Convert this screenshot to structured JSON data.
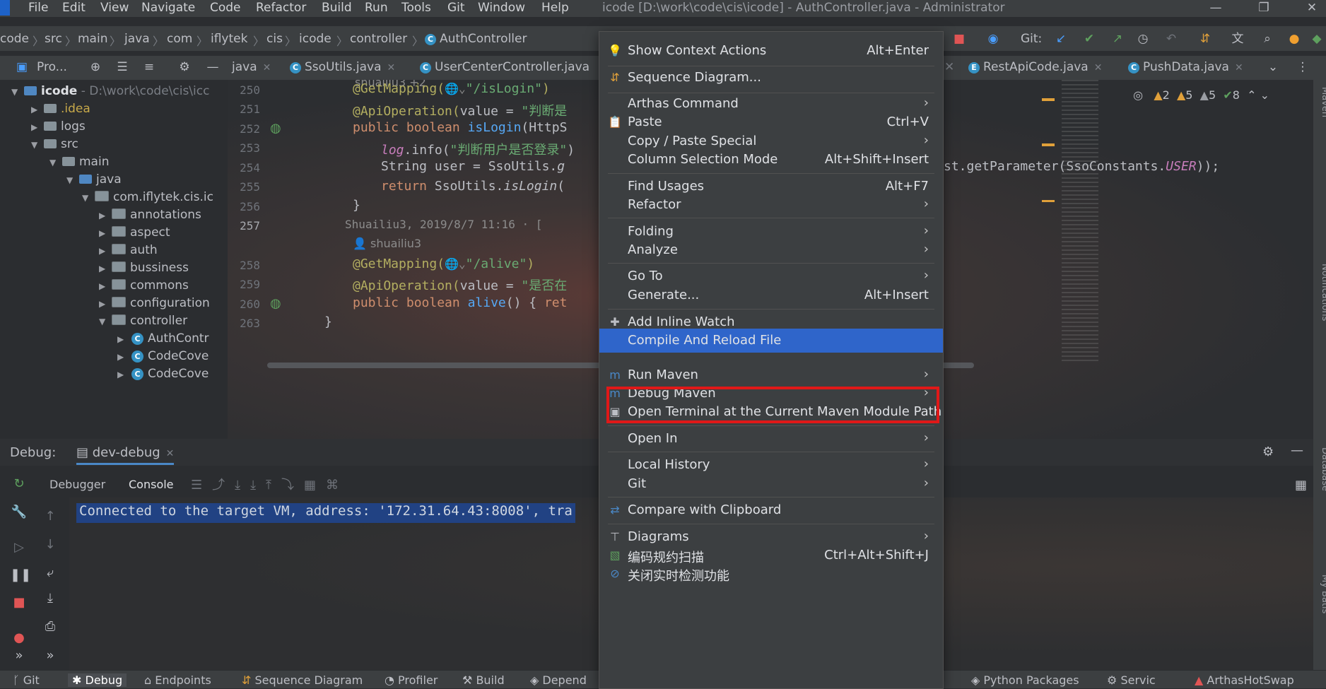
{
  "window": {
    "title": "icode [D:\\work\\code\\cis\\icode] - AuthController.java - Administrator",
    "menu": [
      "File",
      "Edit",
      "View",
      "Navigate",
      "Code",
      "Refactor",
      "Build",
      "Run",
      "Tools",
      "Git",
      "Window",
      "Help"
    ]
  },
  "navbar": {
    "breadcrumbs": [
      "code",
      "src",
      "main",
      "java",
      "com",
      "iflytek",
      "cis",
      "icode",
      "controller",
      "AuthController"
    ],
    "git_label": "Git:"
  },
  "toolbar": {
    "project_label": "Pro...",
    "tabs": [
      {
        "label": "java"
      },
      {
        "label": "SsoUtils.java"
      },
      {
        "label": "UserCenterController.java"
      },
      {
        "label": "RestApiCode.java"
      },
      {
        "label": "PushData.java"
      }
    ]
  },
  "project_tree": [
    {
      "label": "icode",
      "extra": "- D:\\work\\code\\cis\\icc",
      "depth": 0,
      "open": true
    },
    {
      "label": ".idea",
      "depth": 1,
      "open": false
    },
    {
      "label": "logs",
      "depth": 1,
      "open": false
    },
    {
      "label": "src",
      "depth": 1,
      "open": true
    },
    {
      "label": "main",
      "depth": 2,
      "open": true
    },
    {
      "label": "java",
      "depth": 3,
      "open": true
    },
    {
      "label": "com.iflytek.cis.ic",
      "depth": 4,
      "open": true
    },
    {
      "label": "annotations",
      "depth": 5,
      "open": false
    },
    {
      "label": "aspect",
      "depth": 5,
      "open": false
    },
    {
      "label": "auth",
      "depth": 5,
      "open": false
    },
    {
      "label": "bussiness",
      "depth": 5,
      "open": false
    },
    {
      "label": "commons",
      "depth": 5,
      "open": false
    },
    {
      "label": "configuration",
      "depth": 5,
      "open": false
    },
    {
      "label": "controller",
      "depth": 5,
      "open": true
    },
    {
      "label": "AuthContr",
      "depth": 6,
      "open": false
    },
    {
      "label": "CodeCove",
      "depth": 6,
      "open": false
    },
    {
      "label": "CodeCove",
      "depth": 6,
      "open": false
    }
  ],
  "editor": {
    "top_fragment": "shuailiu3 +2",
    "line_numbers": [
      "250",
      "251",
      "252",
      "253",
      "254",
      "255",
      "256",
      "257",
      "",
      "258",
      "259",
      "260",
      "263"
    ],
    "blame": "Shuailiu3, 2019/8/7 11:16 · [",
    "author": "shuailiu3",
    "continuation": "st.getParameter(SsoConstants.",
    "continuation_field": "USER",
    "continuation_end": "));",
    "inspections": {
      "w1": "2",
      "w2": "5",
      "w3": "5",
      "ok": "8"
    }
  },
  "debug": {
    "label": "Debug:",
    "config": "dev-debug",
    "tabs": [
      "Debugger",
      "Console"
    ],
    "console_text": "Connected to the target VM, address: '172.31.64.43:8008', tra"
  },
  "statusbar": [
    "Git",
    "Debug",
    "Endpoints",
    "Sequence Diagram",
    "Profiler",
    "Build",
    "Depend",
    "Python Packages",
    "Servic",
    "ArthasHotSwap"
  ],
  "right_strip": [
    "Maven",
    "Notifications",
    "Database",
    "My Batis"
  ],
  "context_menu": {
    "items": [
      {
        "label": "Show Context Actions",
        "shortcut": "Alt+Enter",
        "icon": "bulb-icon"
      },
      {
        "label": "Sequence Diagram...",
        "icon": "sequence-diagram-icon"
      },
      {
        "label": "Arthas Command",
        "submenu": true
      },
      {
        "label": "Paste",
        "shortcut": "Ctrl+V",
        "icon": "paste-icon"
      },
      {
        "label": "Copy / Paste Special",
        "submenu": true
      },
      {
        "label": "Column Selection Mode",
        "shortcut": "Alt+Shift+Insert"
      },
      {
        "label": "Find Usages",
        "shortcut": "Alt+F7"
      },
      {
        "label": "Refactor",
        "submenu": true
      },
      {
        "label": "Folding",
        "submenu": true
      },
      {
        "label": "Analyze",
        "submenu": true
      },
      {
        "label": "Go To",
        "submenu": true
      },
      {
        "label": "Generate...",
        "shortcut": "Alt+Insert"
      },
      {
        "label": "Add Inline Watch",
        "icon": "add-watch-icon"
      },
      {
        "label": "Compile And Reload File",
        "selected": true
      },
      {
        "label": "Run Maven",
        "submenu": true,
        "icon": "maven-icon"
      },
      {
        "label": "Debug Maven",
        "submenu": true,
        "icon": "maven-debug-icon"
      },
      {
        "label": "Open Terminal at the Current Maven Module Path",
        "icon": "terminal-icon"
      },
      {
        "label": "Open In",
        "submenu": true
      },
      {
        "label": "Local History",
        "submenu": true
      },
      {
        "label": "Git",
        "submenu": true
      },
      {
        "label": "Compare with Clipboard",
        "icon": "compare-icon"
      },
      {
        "label": "Diagrams",
        "submenu": true,
        "icon": "diagram-icon"
      },
      {
        "label": "编码规约扫描",
        "shortcut": "Ctrl+Alt+Shift+J",
        "icon": "scan-icon"
      },
      {
        "label": "关闭实时检测功能",
        "icon": "disable-icon"
      }
    ]
  },
  "colors": {
    "selection": "#2f65ca",
    "highlight_box": "#e01818",
    "accent": "#3592c4"
  }
}
